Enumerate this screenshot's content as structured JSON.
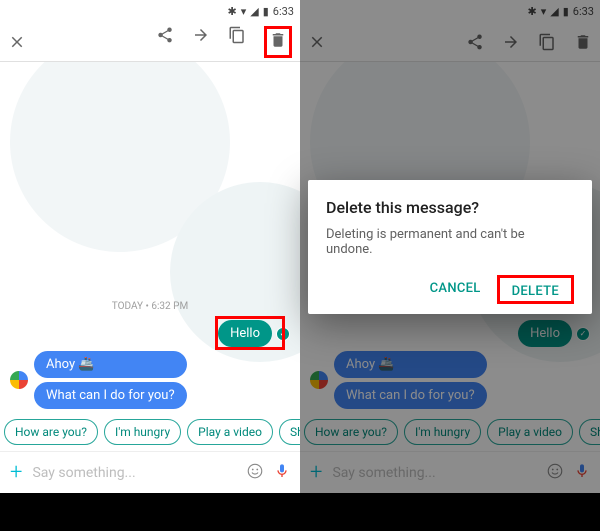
{
  "status": {
    "time": "6:33"
  },
  "appbar": {
    "close": "✕",
    "share": "share",
    "forward": "→",
    "copy": "copy",
    "delete": "delete"
  },
  "chat": {
    "timestamp": "TODAY • 6:32 PM",
    "sent": {
      "text": "Hello"
    },
    "recv1": {
      "text": "Ahoy 🚢"
    },
    "recv2": {
      "text": "What can I do for you?"
    }
  },
  "chips": {
    "c0": "How are you?",
    "c1": "I'm hungry",
    "c2": "Play a video",
    "c3": "Show me m"
  },
  "input": {
    "plus": "+",
    "placeholder": "Say something..."
  },
  "dialog": {
    "title": "Delete this message?",
    "body": "Deleting is permanent and can't be undone.",
    "cancel": "CANCEL",
    "delete": "DELETE"
  }
}
